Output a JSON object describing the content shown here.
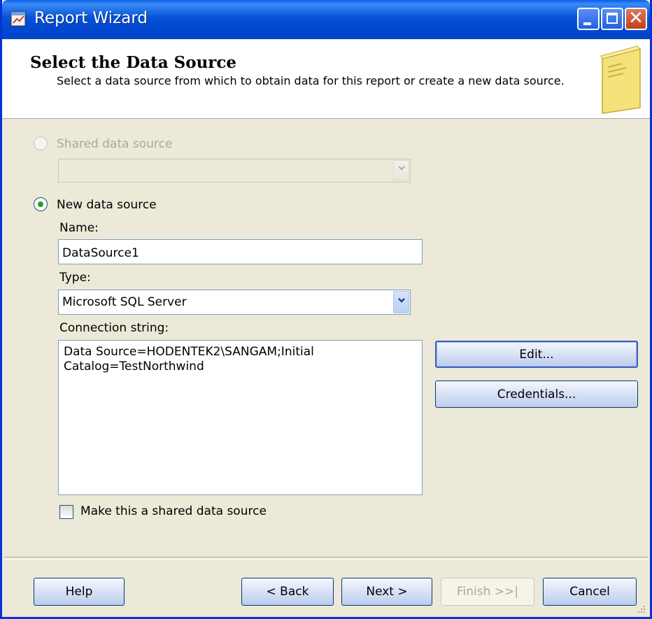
{
  "window": {
    "title": "Report Wizard"
  },
  "header": {
    "title": "Select the Data Source",
    "description": "Select a data source from which to obtain data for this report or create a new data source."
  },
  "shared_source": {
    "label": "Shared data source",
    "selected": false,
    "enabled": false,
    "combo_value": ""
  },
  "new_source": {
    "label": "New data source",
    "selected": true,
    "name_label": "Name:",
    "name_value": "DataSource1",
    "type_label": "Type:",
    "type_value": "Microsoft SQL Server",
    "connection_label": "Connection string:",
    "connection_value": "Data Source=HODENTEK2\\SANGAM;Initial Catalog=TestNorthwind",
    "edit_button": "Edit...",
    "credentials_button": "Credentials...",
    "make_shared_label": "Make this a shared data source",
    "make_shared_checked": false
  },
  "footer": {
    "help": "Help",
    "back": "< Back",
    "next": "Next >",
    "finish": "Finish >>|",
    "cancel": "Cancel"
  },
  "colors": {
    "title_bar": "#0054e3",
    "dialog_bg": "#ece9d8",
    "selected_radio": "#21a121",
    "close_button": "#d1542b"
  },
  "icons": [
    "report-wizard-app-icon",
    "minimize-icon",
    "maximize-icon",
    "close-icon",
    "wizard-page-icon",
    "chevron-down-icon",
    "resize-grip-icon"
  ]
}
